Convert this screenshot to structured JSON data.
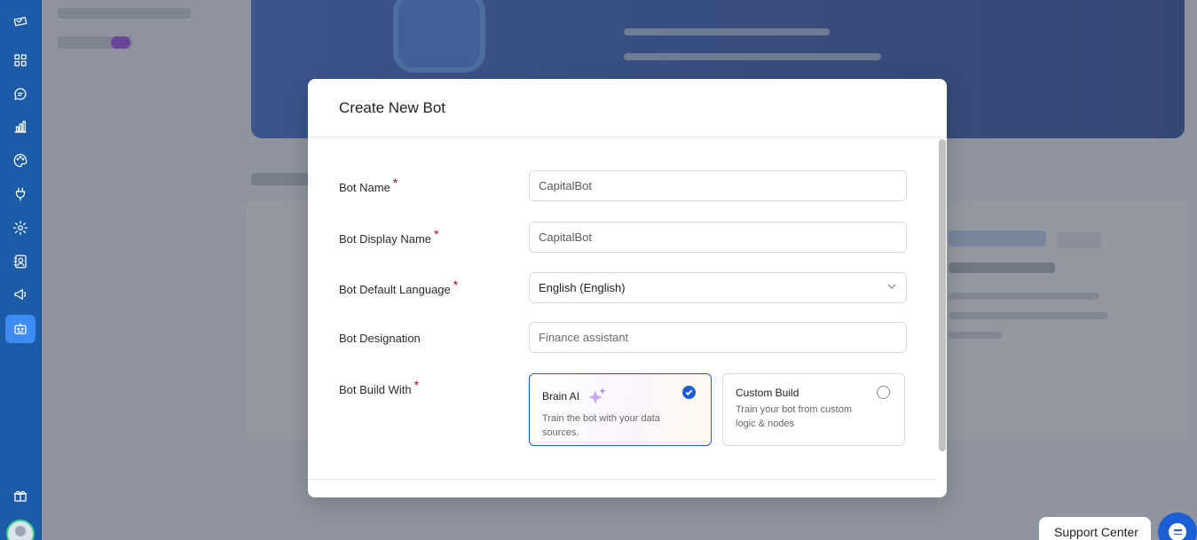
{
  "modal": {
    "title": "Create New Bot",
    "fields": {
      "bot_name": {
        "label": "Bot Name",
        "required": true,
        "value": "CapitalBot"
      },
      "bot_display_name": {
        "label": "Bot Display Name",
        "required": true,
        "value": "CapitalBot"
      },
      "bot_default_language": {
        "label": "Bot Default Language",
        "required": true,
        "value": "English (English)"
      },
      "bot_designation": {
        "label": "Bot Designation",
        "required": false,
        "placeholder": "Finance assistant"
      },
      "bot_build_with": {
        "label": "Bot Build With",
        "required": true
      }
    },
    "required_mark": "*",
    "build_options": [
      {
        "title": "Brain AI",
        "description": "Train the bot with your data sources.",
        "selected": true
      },
      {
        "title": "Custom Build",
        "description": "Train your bot from custom logic & nodes",
        "selected": false
      }
    ]
  },
  "sidebar": {
    "icons": [
      "logo-icon",
      "dashboard-icon",
      "chat-icon",
      "analytics-icon",
      "palette-icon",
      "plug-icon",
      "settings-icon",
      "contacts-icon",
      "megaphone-icon",
      "bot-icon",
      "gift-icon",
      "avatar"
    ],
    "active": "bot-icon"
  },
  "support": {
    "label": "Support Center"
  },
  "colors": {
    "sidebar": "#1c5ba8",
    "primary": "#1a5dd8",
    "required": "#d0021b"
  }
}
